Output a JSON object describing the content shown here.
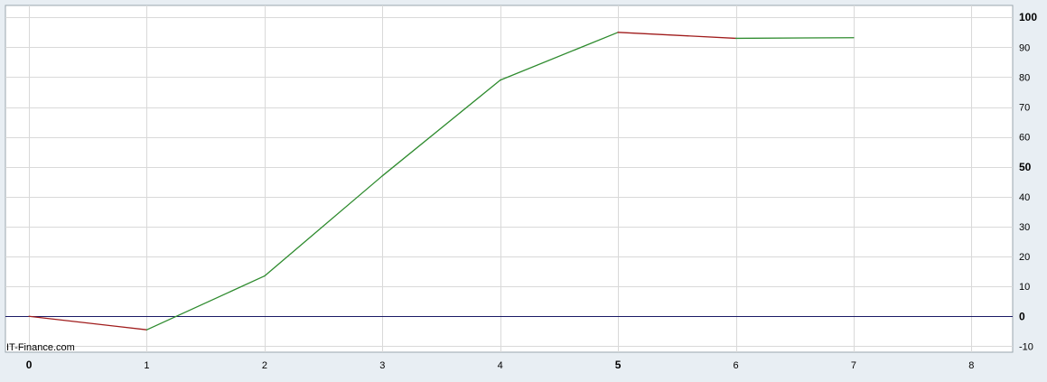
{
  "watermark": "IT-Finance.com",
  "colors": {
    "background": "#e8eef3",
    "plot_background": "#ffffff",
    "grid": "#d9d9d9",
    "zero_line": "#1a1a66",
    "rising": "#2e8b2e",
    "falling": "#a01c1c"
  },
  "chart_data": {
    "type": "line",
    "x": [
      0,
      1,
      2,
      3,
      4,
      5,
      6,
      7
    ],
    "series": [
      {
        "values": [
          0,
          -4.5,
          13.5,
          47,
          79,
          95,
          93,
          93.2
        ]
      }
    ],
    "xlim": [
      -0.2,
      8.35
    ],
    "ylim": [
      -12,
      104
    ],
    "x_ticks": [
      {
        "value": 0,
        "label": "0",
        "major": true
      },
      {
        "value": 1,
        "label": "1",
        "major": false
      },
      {
        "value": 2,
        "label": "2",
        "major": false
      },
      {
        "value": 3,
        "label": "3",
        "major": false
      },
      {
        "value": 4,
        "label": "4",
        "major": false
      },
      {
        "value": 5,
        "label": "5",
        "major": true
      },
      {
        "value": 6,
        "label": "6",
        "major": false
      },
      {
        "value": 7,
        "label": "7",
        "major": false
      },
      {
        "value": 8,
        "label": "8",
        "major": false
      }
    ],
    "y_ticks": [
      {
        "value": -10,
        "label": "-10",
        "major": false
      },
      {
        "value": 0,
        "label": "0",
        "major": true
      },
      {
        "value": 10,
        "label": "10",
        "major": false
      },
      {
        "value": 20,
        "label": "20",
        "major": false
      },
      {
        "value": 30,
        "label": "30",
        "major": false
      },
      {
        "value": 40,
        "label": "40",
        "major": false
      },
      {
        "value": 50,
        "label": "50",
        "major": true
      },
      {
        "value": 60,
        "label": "60",
        "major": false
      },
      {
        "value": 70,
        "label": "70",
        "major": false
      },
      {
        "value": 80,
        "label": "80",
        "major": false
      },
      {
        "value": 90,
        "label": "90",
        "major": false
      },
      {
        "value": 100,
        "label": "100",
        "major": true
      }
    ],
    "y_axis_position": "right",
    "grid": true,
    "legend": "none"
  }
}
